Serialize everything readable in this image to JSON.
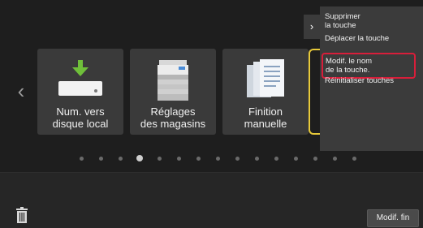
{
  "tiles": [
    {
      "label_line1": "Num. vers",
      "label_line2": "disque local",
      "icon": "download-to-disk-icon"
    },
    {
      "label_line1": "Réglages",
      "label_line2": "des magasins",
      "icon": "printer-icon"
    },
    {
      "label_line1": "Finition",
      "label_line2": "manuelle",
      "icon": "documents-stack-icon"
    }
  ],
  "pagination": {
    "total": 15,
    "active_index": 3
  },
  "menu": {
    "items": [
      {
        "line1": "Supprimer",
        "line2": "la touche"
      },
      {
        "line1": "Déplacer la touche",
        "line2": ""
      },
      {
        "line1": "Modif. le nom",
        "line2": "de la touche."
      },
      {
        "line1": "Réinitialiser touches",
        "line2": ""
      }
    ],
    "highlighted_index": 2
  },
  "bottom": {
    "done_label": "Modif. fin"
  },
  "colors": {
    "highlight": "#d81e3a",
    "selection_border": "#e7c93a",
    "download_arrow": "#6fbf3a"
  }
}
